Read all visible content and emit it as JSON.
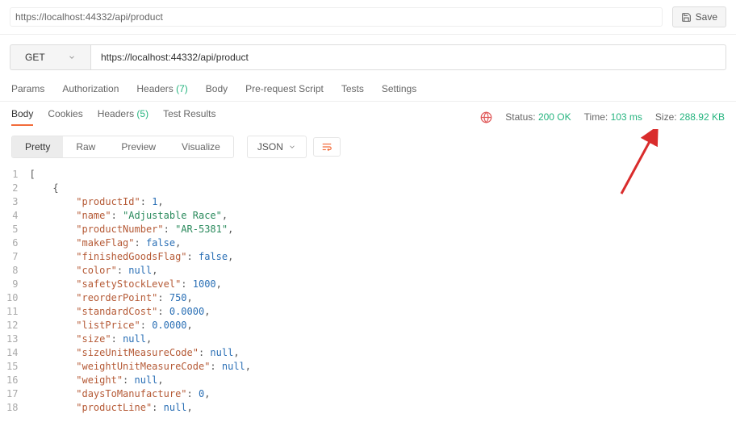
{
  "topbar": {
    "tab_title": "https://localhost:44332/api/product",
    "save_label": "Save"
  },
  "request": {
    "method": "GET",
    "url": "https://localhost:44332/api/product"
  },
  "req_tabs": {
    "params": "Params",
    "auth": "Authorization",
    "headers_label": "Headers",
    "headers_count": "(7)",
    "body": "Body",
    "prereq": "Pre-request Script",
    "tests": "Tests",
    "settings": "Settings"
  },
  "resp_tabs": {
    "body": "Body",
    "cookies": "Cookies",
    "headers_label": "Headers",
    "headers_count": "(5)",
    "test_results": "Test Results"
  },
  "status": {
    "status_label": "Status:",
    "status_value": "200 OK",
    "time_label": "Time:",
    "time_value": "103 ms",
    "size_label": "Size:",
    "size_value": "288.92 KB"
  },
  "view": {
    "pretty": "Pretty",
    "raw": "Raw",
    "preview": "Preview",
    "visualize": "Visualize",
    "format": "JSON"
  },
  "code_lines": [
    {
      "n": 1,
      "indent": 0,
      "tokens": [
        {
          "t": "p",
          "v": "["
        }
      ]
    },
    {
      "n": 2,
      "indent": 1,
      "tokens": [
        {
          "t": "p",
          "v": "{"
        }
      ]
    },
    {
      "n": 3,
      "indent": 2,
      "tokens": [
        {
          "t": "key",
          "v": "\"productId\""
        },
        {
          "t": "p",
          "v": ": "
        },
        {
          "t": "num",
          "v": "1"
        },
        {
          "t": "p",
          "v": ","
        }
      ]
    },
    {
      "n": 4,
      "indent": 2,
      "tokens": [
        {
          "t": "key",
          "v": "\"name\""
        },
        {
          "t": "p",
          "v": ": "
        },
        {
          "t": "str",
          "v": "\"Adjustable Race\""
        },
        {
          "t": "p",
          "v": ","
        }
      ]
    },
    {
      "n": 5,
      "indent": 2,
      "tokens": [
        {
          "t": "key",
          "v": "\"productNumber\""
        },
        {
          "t": "p",
          "v": ": "
        },
        {
          "t": "str",
          "v": "\"AR-5381\""
        },
        {
          "t": "p",
          "v": ","
        }
      ]
    },
    {
      "n": 6,
      "indent": 2,
      "tokens": [
        {
          "t": "key",
          "v": "\"makeFlag\""
        },
        {
          "t": "p",
          "v": ": "
        },
        {
          "t": "kw",
          "v": "false"
        },
        {
          "t": "p",
          "v": ","
        }
      ]
    },
    {
      "n": 7,
      "indent": 2,
      "tokens": [
        {
          "t": "key",
          "v": "\"finishedGoodsFlag\""
        },
        {
          "t": "p",
          "v": ": "
        },
        {
          "t": "kw",
          "v": "false"
        },
        {
          "t": "p",
          "v": ","
        }
      ]
    },
    {
      "n": 8,
      "indent": 2,
      "tokens": [
        {
          "t": "key",
          "v": "\"color\""
        },
        {
          "t": "p",
          "v": ": "
        },
        {
          "t": "kw",
          "v": "null"
        },
        {
          "t": "p",
          "v": ","
        }
      ]
    },
    {
      "n": 9,
      "indent": 2,
      "tokens": [
        {
          "t": "key",
          "v": "\"safetyStockLevel\""
        },
        {
          "t": "p",
          "v": ": "
        },
        {
          "t": "num",
          "v": "1000"
        },
        {
          "t": "p",
          "v": ","
        }
      ]
    },
    {
      "n": 10,
      "indent": 2,
      "tokens": [
        {
          "t": "key",
          "v": "\"reorderPoint\""
        },
        {
          "t": "p",
          "v": ": "
        },
        {
          "t": "num",
          "v": "750"
        },
        {
          "t": "p",
          "v": ","
        }
      ]
    },
    {
      "n": 11,
      "indent": 2,
      "tokens": [
        {
          "t": "key",
          "v": "\"standardCost\""
        },
        {
          "t": "p",
          "v": ": "
        },
        {
          "t": "num",
          "v": "0.0000"
        },
        {
          "t": "p",
          "v": ","
        }
      ]
    },
    {
      "n": 12,
      "indent": 2,
      "tokens": [
        {
          "t": "key",
          "v": "\"listPrice\""
        },
        {
          "t": "p",
          "v": ": "
        },
        {
          "t": "num",
          "v": "0.0000"
        },
        {
          "t": "p",
          "v": ","
        }
      ]
    },
    {
      "n": 13,
      "indent": 2,
      "tokens": [
        {
          "t": "key",
          "v": "\"size\""
        },
        {
          "t": "p",
          "v": ": "
        },
        {
          "t": "kw",
          "v": "null"
        },
        {
          "t": "p",
          "v": ","
        }
      ]
    },
    {
      "n": 14,
      "indent": 2,
      "tokens": [
        {
          "t": "key",
          "v": "\"sizeUnitMeasureCode\""
        },
        {
          "t": "p",
          "v": ": "
        },
        {
          "t": "kw",
          "v": "null"
        },
        {
          "t": "p",
          "v": ","
        }
      ]
    },
    {
      "n": 15,
      "indent": 2,
      "tokens": [
        {
          "t": "key",
          "v": "\"weightUnitMeasureCode\""
        },
        {
          "t": "p",
          "v": ": "
        },
        {
          "t": "kw",
          "v": "null"
        },
        {
          "t": "p",
          "v": ","
        }
      ]
    },
    {
      "n": 16,
      "indent": 2,
      "tokens": [
        {
          "t": "key",
          "v": "\"weight\""
        },
        {
          "t": "p",
          "v": ": "
        },
        {
          "t": "kw",
          "v": "null"
        },
        {
          "t": "p",
          "v": ","
        }
      ]
    },
    {
      "n": 17,
      "indent": 2,
      "tokens": [
        {
          "t": "key",
          "v": "\"daysToManufacture\""
        },
        {
          "t": "p",
          "v": ": "
        },
        {
          "t": "num",
          "v": "0"
        },
        {
          "t": "p",
          "v": ","
        }
      ]
    },
    {
      "n": 18,
      "indent": 2,
      "tokens": [
        {
          "t": "key",
          "v": "\"productLine\""
        },
        {
          "t": "p",
          "v": ": "
        },
        {
          "t": "kw",
          "v": "null"
        },
        {
          "t": "p",
          "v": ","
        }
      ]
    }
  ]
}
